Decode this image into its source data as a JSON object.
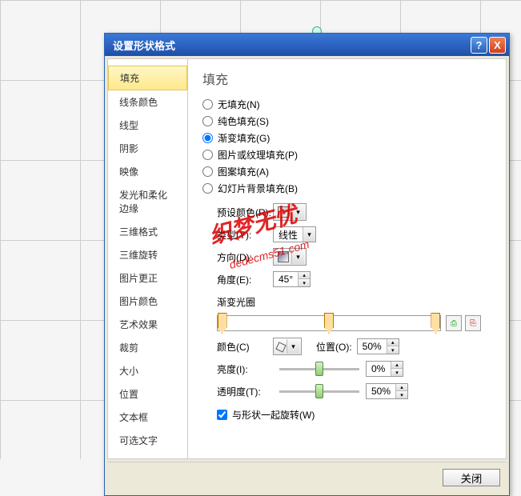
{
  "window": {
    "title": "设置形状格式",
    "help": "?",
    "close": "X"
  },
  "sidebar": {
    "items": [
      "填充",
      "线条颜色",
      "线型",
      "阴影",
      "映像",
      "发光和柔化边缘",
      "三维格式",
      "三维旋转",
      "图片更正",
      "图片颜色",
      "艺术效果",
      "裁剪",
      "大小",
      "位置",
      "文本框",
      "可选文字"
    ],
    "active_index": 0
  },
  "panel": {
    "title": "填充",
    "fill_options": [
      "无填充(N)",
      "纯色填充(S)",
      "渐变填充(G)",
      "图片或纹理填充(P)",
      "图案填充(A)",
      "幻灯片背景填充(B)"
    ],
    "selected_fill": 2,
    "preset_label": "预设颜色(R):",
    "type_label": "类型(Y):",
    "type_value": "线性",
    "direction_label": "方向(D):",
    "angle_label": "角度(E):",
    "angle_value": "45°",
    "stops_label": "渐变光圈",
    "color_label": "颜色(C)",
    "position_label": "位置(O):",
    "position_value": "50%",
    "brightness_label": "亮度(I):",
    "brightness_value": "0%",
    "transparency_label": "透明度(T):",
    "transparency_value": "50%",
    "rotate_check_label": "与形状一起旋转(W)",
    "rotate_checked": true,
    "gradient_stops_pct": [
      2,
      50,
      98
    ]
  },
  "footer": {
    "close": "关闭"
  },
  "watermark": {
    "main": "织梦无忧",
    "sub": "dedecms51.com"
  }
}
